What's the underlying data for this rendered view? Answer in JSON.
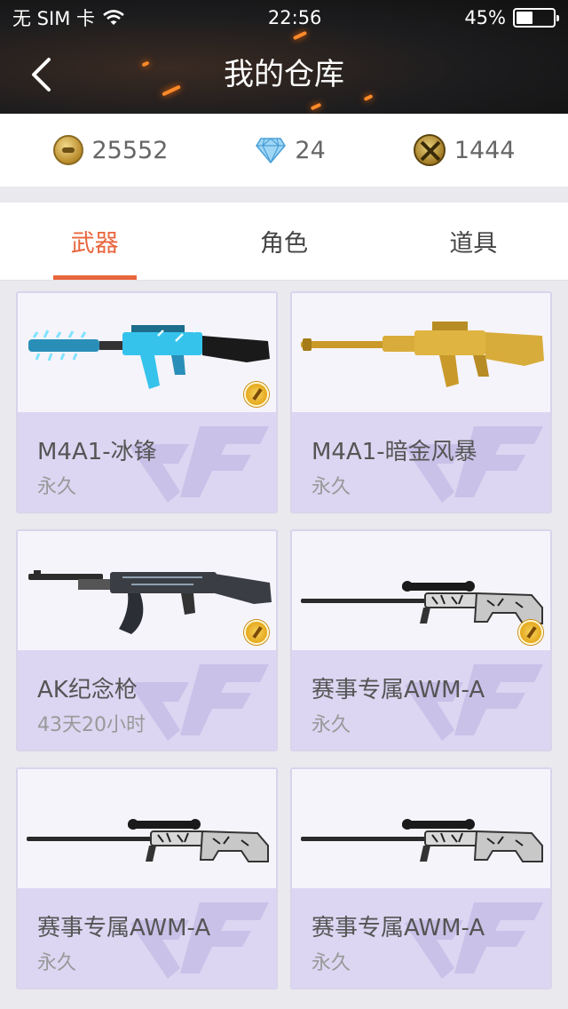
{
  "status_bar": {
    "carrier": "无 SIM 卡",
    "time": "22:56",
    "battery": "45%",
    "battery_level": 0.45
  },
  "header": {
    "title": "我的仓库"
  },
  "currency": {
    "coins": "25552",
    "gems": "24",
    "medals": "1444"
  },
  "tabs": [
    {
      "label": "武器",
      "active": true
    },
    {
      "label": "角色",
      "active": false
    },
    {
      "label": "道具",
      "active": false
    }
  ],
  "items": [
    {
      "name": "M4A1-冰锋",
      "duration": "永久",
      "style": "ice",
      "medal": true
    },
    {
      "name": "M4A1-暗金风暴",
      "duration": "永久",
      "style": "gold",
      "medal": false
    },
    {
      "name": "AK纪念枪",
      "duration": "43天20小时",
      "style": "ak",
      "medal": true
    },
    {
      "name": "赛事专属AWM-A",
      "duration": "永久",
      "style": "sniper",
      "medal": true
    },
    {
      "name": "赛事专属AWM-A",
      "duration": "永久",
      "style": "sniper",
      "medal": false
    },
    {
      "name": "赛事专属AWM-A",
      "duration": "永久",
      "style": "sniper",
      "medal": false
    }
  ],
  "colors": {
    "accent": "#e8663e",
    "card_info_bg": "#dcd6f2",
    "header_bg": "#1c1c1e"
  }
}
